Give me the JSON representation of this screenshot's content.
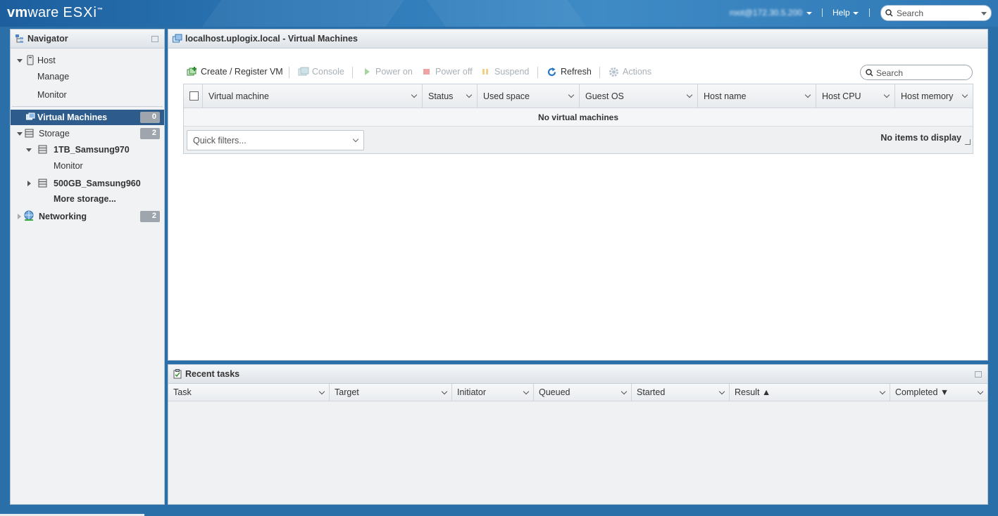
{
  "header": {
    "logo_brand": "vm",
    "logo_ware": "ware",
    "logo_product": "ESXi",
    "logo_tm": "™",
    "user": "root@172.30.5.200",
    "help": "Help",
    "search_placeholder": "Search"
  },
  "navigator": {
    "title": "Navigator",
    "host": "Host",
    "manage": "Manage",
    "monitor": "Monitor",
    "virtual_machines": "Virtual Machines",
    "virtual_machines_count": "0",
    "storage": "Storage",
    "storage_count": "2",
    "datastore1": "1TB_Samsung970",
    "datastore1_monitor": "Monitor",
    "datastore2": "500GB_Samsung960",
    "more_storage": "More storage...",
    "networking": "Networking",
    "networking_count": "2"
  },
  "main": {
    "title": "localhost.uplogix.local - Virtual Machines",
    "toolbar": {
      "create": "Create / Register VM",
      "console": "Console",
      "power_on": "Power on",
      "power_off": "Power off",
      "suspend": "Suspend",
      "refresh": "Refresh",
      "actions": "Actions"
    },
    "search_placeholder": "Search",
    "columns": [
      "Virtual machine",
      "Status",
      "Used space",
      "Guest OS",
      "Host name",
      "Host CPU",
      "Host memory"
    ],
    "empty_message": "No virtual machines",
    "quick_filters": "Quick filters...",
    "no_items": "No items to display"
  },
  "tasks": {
    "title": "Recent tasks",
    "columns": [
      "Task",
      "Target",
      "Initiator",
      "Queued",
      "Started",
      "Result ▲",
      "Completed ▼"
    ]
  },
  "colors": {
    "banner": "#2e7ab8",
    "nav_selected": "#2d5c8c",
    "badge": "#9ea5ad"
  }
}
